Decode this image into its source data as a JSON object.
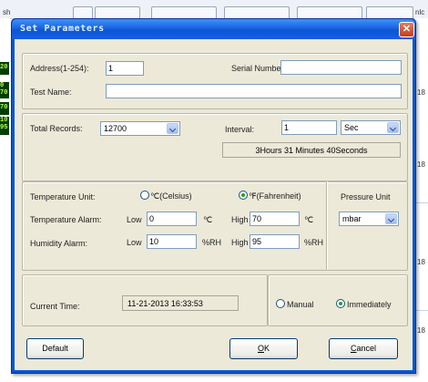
{
  "background": {
    "tab_text_left": "sh",
    "tab_text_right": "nlc",
    "left_bar_texts": [
      "20",
      "0\n70",
      "70",
      "10\n95"
    ],
    "right_numbers": [
      "18",
      "18",
      "18",
      "18"
    ]
  },
  "dialog": {
    "title": "Set Parameters",
    "close_symbol": "✕"
  },
  "device": {
    "address_label": "Address(1-254):",
    "address_value": "1",
    "serial_label": "Serial Number:",
    "serial_value": "",
    "test_name_label": "Test Name:",
    "test_name_value": ""
  },
  "records": {
    "total_label": "Total Records:",
    "total_value": "12700",
    "interval_label": "Interval:",
    "interval_value": "1",
    "interval_unit": "Sec",
    "duration": "3Hours 31 Minutes 40Seconds"
  },
  "temperature": {
    "unit_label": "Temperature Unit:",
    "celsius_label": "℃(Celsius)",
    "fahrenheit_label": "℉(Fahrenheit)",
    "selected_unit": "fahrenheit",
    "alarm_label": "Temperature Alarm:",
    "low_label": "Low",
    "low_value": "0",
    "low_unit": "℃",
    "high_label": "High",
    "high_value": "70",
    "high_unit": "℃"
  },
  "humidity": {
    "alarm_label": "Humidity Alarm:",
    "low_label": "Low",
    "low_value": "10",
    "low_unit": "%RH",
    "high_label": "High",
    "high_value": "95",
    "high_unit": "%RH"
  },
  "pressure": {
    "unit_label": "Pressure Unit",
    "unit_value": "mbar"
  },
  "time": {
    "current_label": "Current Time:",
    "current_value": "11-21-2013 16:33:53",
    "manual_label": "Manual",
    "immediately_label": "Immediately",
    "selected_mode": "immediately"
  },
  "buttons": {
    "default_label": "Default",
    "ok_mnemonic": "O",
    "ok_rest": "K",
    "cancel_mnemonic": "C",
    "cancel_rest": "ancel"
  }
}
